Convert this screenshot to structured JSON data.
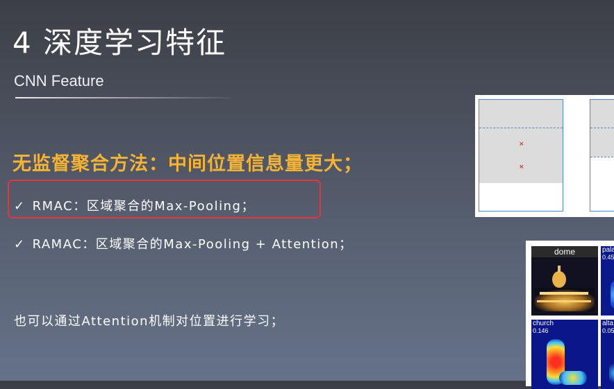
{
  "slide": {
    "title": "4 深度学习特征",
    "subtitle": "CNN Feature",
    "highlight": "无监督聚合方法：中间位置信息量更大；",
    "bullets": [
      {
        "check": "✓",
        "text": "RMAC：区域聚合的Max-Pooling；"
      },
      {
        "check": "✓",
        "text": "RAMAC：区域聚合的Max-Pooling + Attention；"
      }
    ],
    "note": "也可以通过Attention机制对位置进行学习；"
  },
  "figure_heatmaps": {
    "image_label": "dome",
    "cells": [
      {
        "label": "pala",
        "score": "0.45"
      },
      {
        "label": "church",
        "score": "0.146"
      },
      {
        "label": "alta",
        "score": "0.05"
      }
    ]
  },
  "colors": {
    "highlight": "#f7b334",
    "box_border": "#e8323c",
    "diagram_border": "#4a86c8"
  }
}
